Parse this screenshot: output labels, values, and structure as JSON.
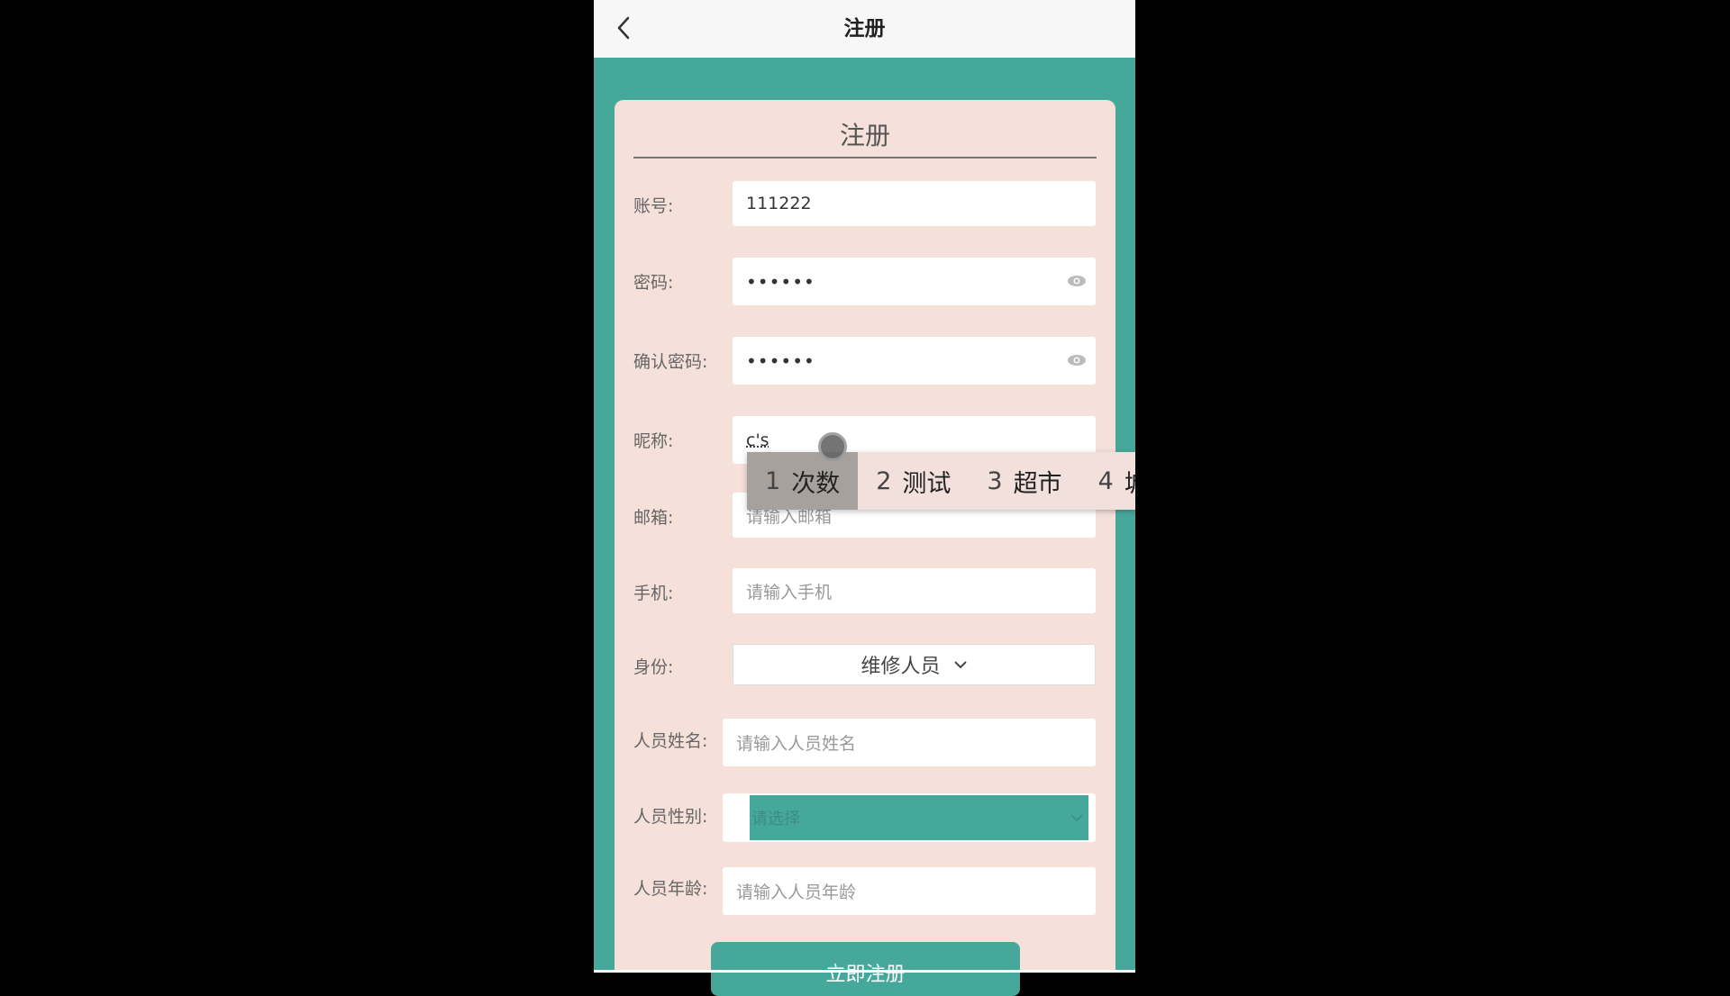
{
  "navbar": {
    "title": "注册",
    "back_icon": "chevron-left-icon"
  },
  "card": {
    "title": "注册"
  },
  "form": {
    "account": {
      "label": "账号:",
      "value": "111222"
    },
    "password": {
      "label": "密码:",
      "value": "••••••"
    },
    "confirm_password": {
      "label": "确认密码:",
      "value": "••••••"
    },
    "nickname": {
      "label": "昵称:",
      "value": "c's"
    },
    "email": {
      "label": "邮箱:",
      "placeholder": "请输入邮箱"
    },
    "phone": {
      "label": "手机:",
      "placeholder": "请输入手机"
    },
    "role": {
      "label": "身份:",
      "value": "维修人员"
    },
    "staff_name": {
      "label": "人员姓名:",
      "placeholder": "请输入人员姓名"
    },
    "staff_gender": {
      "label": "人员性别:",
      "placeholder": "请选择"
    },
    "staff_age": {
      "label": "人员年龄:",
      "placeholder": "请输入人员年龄"
    },
    "submit_label": "立即注册"
  },
  "ime": {
    "candidates": [
      {
        "num": "1",
        "text": "次数"
      },
      {
        "num": "2",
        "text": "测试"
      },
      {
        "num": "3",
        "text": "超市"
      },
      {
        "num": "4",
        "text": "城市"
      }
    ]
  },
  "colors": {
    "accent": "#46a89b",
    "card": "#f5e0da"
  }
}
